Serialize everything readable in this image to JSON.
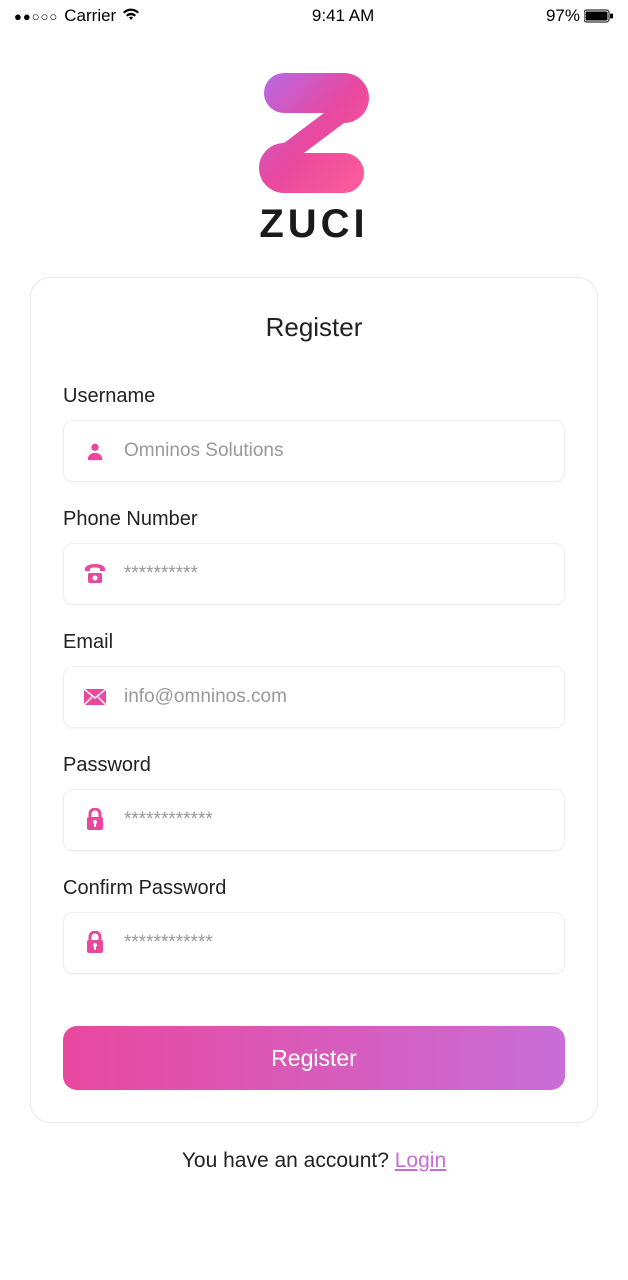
{
  "statusBar": {
    "carrier": "Carrier",
    "time": "9:41 AM",
    "battery": "97%"
  },
  "brand": {
    "name": "ZUCI"
  },
  "card": {
    "title": "Register"
  },
  "fields": {
    "username": {
      "label": "Username",
      "placeholder": "Omninos Solutions"
    },
    "phone": {
      "label": "Phone Number",
      "placeholder": "**********"
    },
    "email": {
      "label": "Email",
      "placeholder": "info@omninos.com"
    },
    "password": {
      "label": "Password",
      "placeholder": "************"
    },
    "confirm": {
      "label": "Confirm Password",
      "placeholder": "************"
    }
  },
  "buttons": {
    "register": "Register"
  },
  "footer": {
    "prompt": "You have an account? ",
    "loginLink": "Login"
  }
}
